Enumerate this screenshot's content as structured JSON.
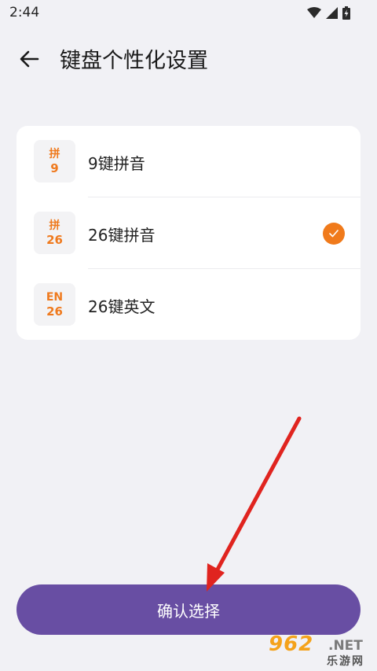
{
  "status_bar": {
    "time": "2:44",
    "icons": [
      "wifi-icon",
      "signal-icon",
      "battery-charging-icon"
    ]
  },
  "header": {
    "back_icon": "arrow-left-icon",
    "title": "键盘个性化设置"
  },
  "options": [
    {
      "icon_top": "拼",
      "icon_bottom": "9",
      "label": "9键拼音",
      "selected": false
    },
    {
      "icon_top": "拼",
      "icon_bottom": "26",
      "label": "26键拼音",
      "selected": true
    },
    {
      "icon_top": "EN",
      "icon_bottom": "26",
      "label": "26键英文",
      "selected": false
    }
  ],
  "confirm_button": {
    "label": "确认选择"
  },
  "watermark": {
    "digits": "962",
    "net": ".NET",
    "chinese": "乐游网"
  },
  "colors": {
    "accent": "#f07a1b",
    "button": "#684ea3",
    "background": "#f1f1f5",
    "annotation_arrow": "#e0241f"
  }
}
